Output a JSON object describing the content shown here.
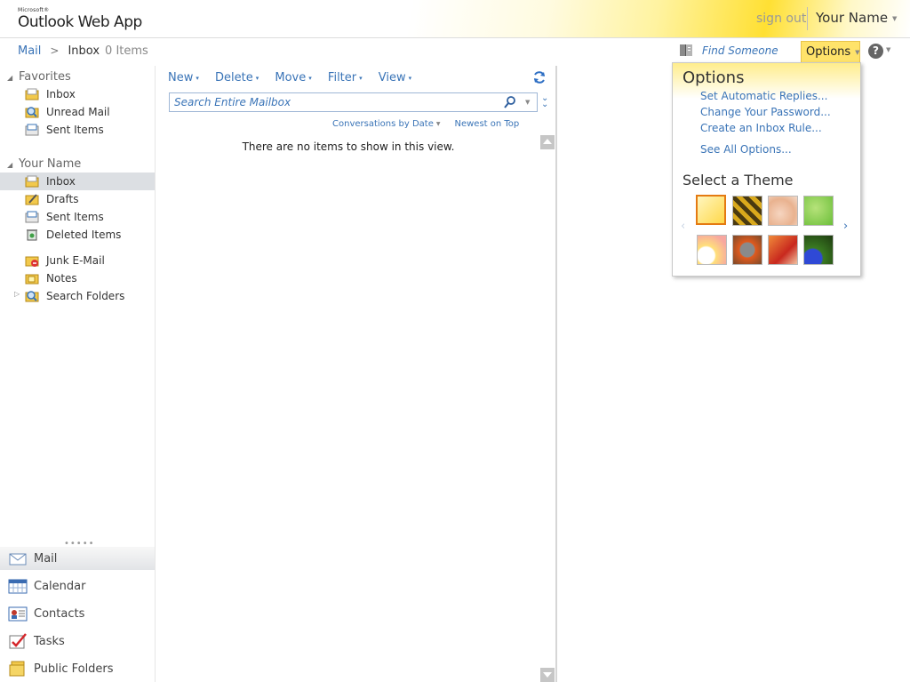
{
  "header": {
    "brand_small": "Microsoft®",
    "brand": "Outlook Web App",
    "sign_out": "sign out",
    "user_name": "Your Name"
  },
  "breadcrumb": {
    "root": "Mail",
    "separator": ">",
    "current": "Inbox",
    "count": "0 Items"
  },
  "topbar": {
    "find_someone": "Find Someone",
    "options": "Options",
    "help": "?"
  },
  "nav": {
    "favorites": {
      "title": "Favorites",
      "items": [
        {
          "label": "Inbox",
          "icon": "inbox-folder-icon"
        },
        {
          "label": "Unread Mail",
          "icon": "search-folder-icon"
        },
        {
          "label": "Sent Items",
          "icon": "sent-items-icon"
        }
      ]
    },
    "mailbox": {
      "title": "Your Name",
      "items": [
        {
          "label": "Inbox",
          "icon": "inbox-folder-icon",
          "selected": true
        },
        {
          "label": "Drafts",
          "icon": "drafts-icon"
        },
        {
          "label": "Sent Items",
          "icon": "sent-items-icon"
        },
        {
          "label": "Deleted Items",
          "icon": "deleted-items-icon"
        },
        {
          "label": "Junk E-Mail",
          "icon": "junk-mail-icon"
        },
        {
          "label": "Notes",
          "icon": "notes-icon"
        },
        {
          "label": "Search Folders",
          "icon": "search-folder-icon"
        }
      ]
    },
    "modules": [
      {
        "label": "Mail",
        "icon": "mail-icon",
        "selected": true
      },
      {
        "label": "Calendar",
        "icon": "calendar-icon"
      },
      {
        "label": "Contacts",
        "icon": "contacts-icon"
      },
      {
        "label": "Tasks",
        "icon": "tasks-icon"
      },
      {
        "label": "Public Folders",
        "icon": "public-folders-icon"
      }
    ]
  },
  "list": {
    "toolbar": [
      "New",
      "Delete",
      "Move",
      "Filter",
      "View"
    ],
    "search_placeholder": "Search Entire Mailbox",
    "sort_by": "Conversations by Date",
    "sort_order": "Newest on Top",
    "empty_message": "There are no items to show in this view."
  },
  "options_panel": {
    "title": "Options",
    "links": [
      "Set Automatic Replies...",
      "Change Your Password...",
      "Create an Inbox Rule...",
      "See All Options..."
    ],
    "theme_title": "Select a Theme",
    "themes": [
      {
        "name": "theme-default",
        "selected": true
      },
      {
        "name": "theme-bees"
      },
      {
        "name": "theme-sand"
      },
      {
        "name": "theme-green"
      },
      {
        "name": "theme-bubbles"
      },
      {
        "name": "theme-robot"
      },
      {
        "name": "theme-leaves"
      },
      {
        "name": "theme-creature"
      }
    ]
  },
  "colors": {
    "link": "#3a74b7",
    "options_highlight": "#ffe36a",
    "selected_folder": "#dcdfe3",
    "theme_selected_border": "#e47a12"
  }
}
